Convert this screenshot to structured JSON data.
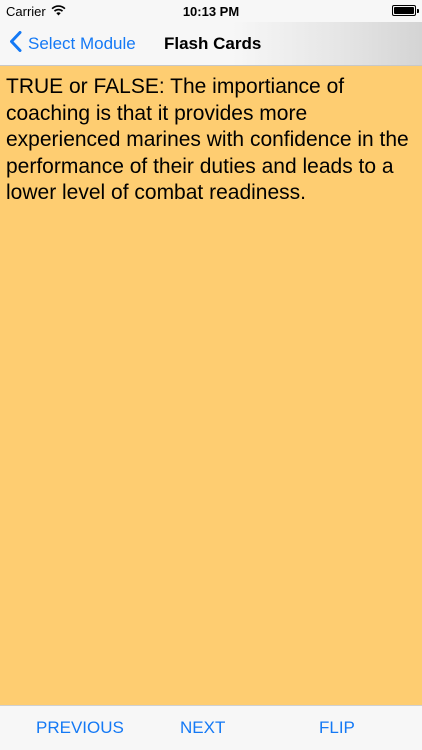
{
  "status_bar": {
    "carrier": "Carrier",
    "time": "10:13 PM",
    "wifi_icon": "wifi-icon",
    "battery_icon": "battery-icon"
  },
  "nav": {
    "back_label": "Select Module",
    "back_icon": "chevron-left-icon",
    "title": "Flash Cards"
  },
  "card": {
    "text": "TRUE or FALSE: The importiance of coaching is that it provides more experienced marines with confidence in the performance of their duties and leads to a lower level of combat readiness.",
    "background_color": "#fecd71"
  },
  "toolbar": {
    "previous_label": "PREVIOUS",
    "next_label": "NEXT",
    "flip_label": "FLIP"
  },
  "colors": {
    "accent": "#1479f5"
  }
}
